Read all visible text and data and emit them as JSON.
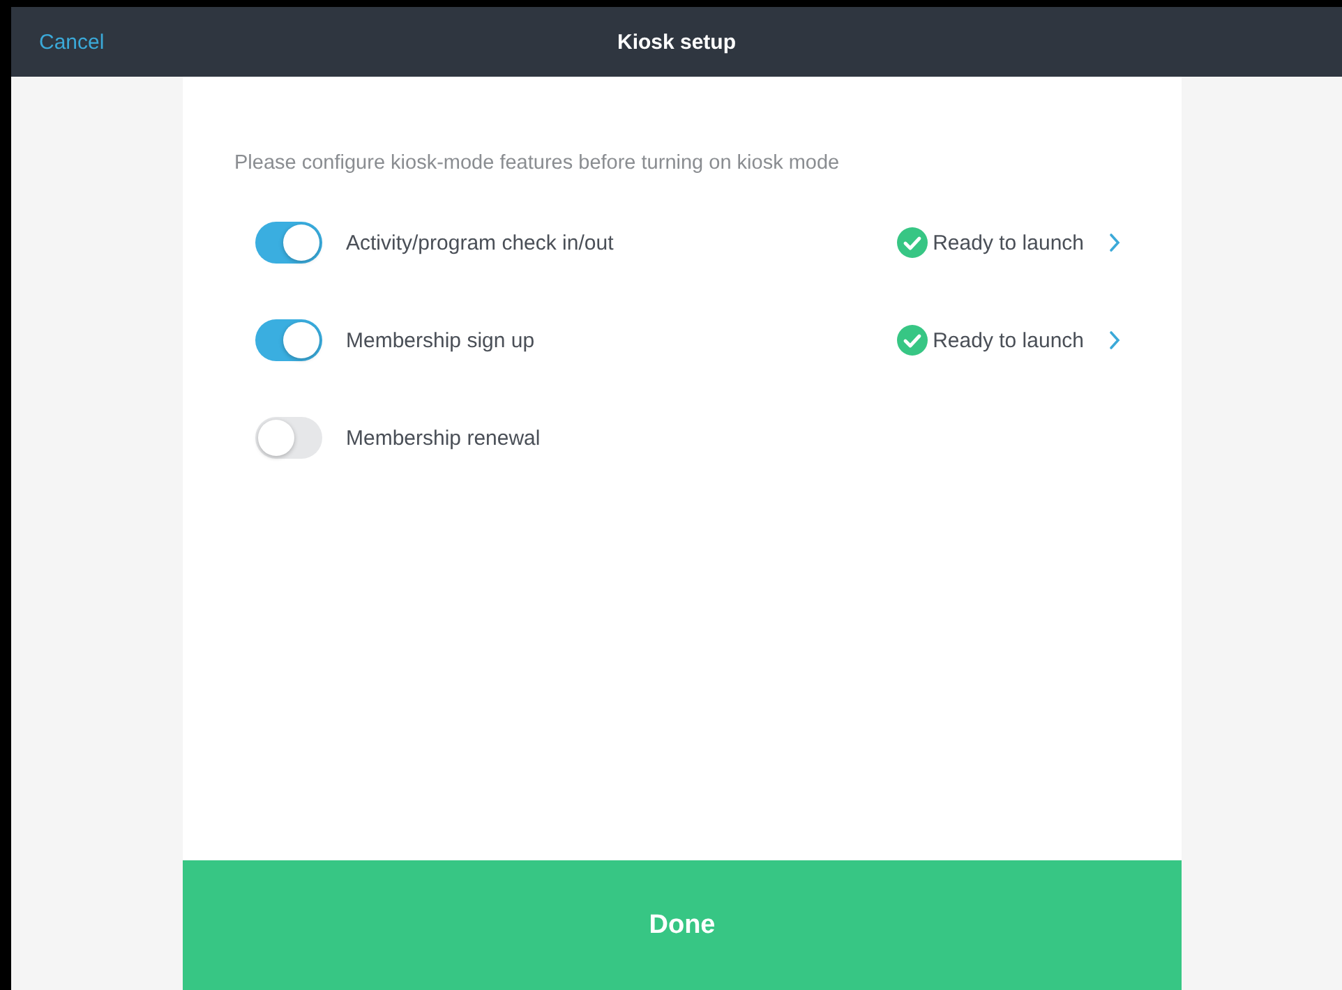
{
  "header": {
    "cancel": "Cancel",
    "title": "Kiosk setup"
  },
  "intro": "Please configure kiosk-mode features before turning on kiosk mode",
  "features": [
    {
      "label": "Activity/program check in/out",
      "on": true,
      "status": "Ready to launch"
    },
    {
      "label": "Membership sign up",
      "on": true,
      "status": "Ready to launch"
    },
    {
      "label": "Membership renewal",
      "on": false
    }
  ],
  "done": "Done"
}
